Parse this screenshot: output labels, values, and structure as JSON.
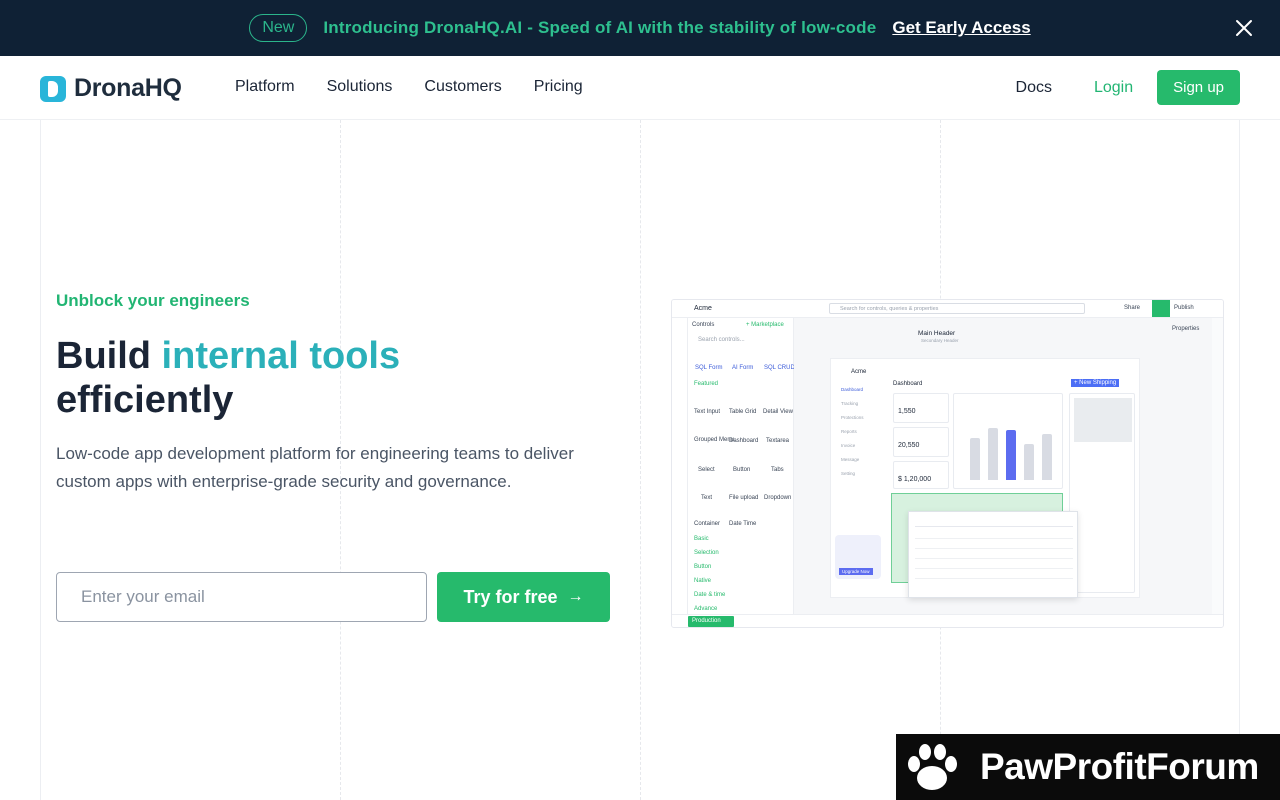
{
  "announcement": {
    "badge": "New",
    "message": "Introducing DronaHQ.AI - Speed of AI with the stability of low-code",
    "cta": "Get Early Access"
  },
  "brand": {
    "name": "DronaHQ"
  },
  "nav": {
    "links": [
      "Platform",
      "Solutions",
      "Customers",
      "Pricing"
    ],
    "docs": "Docs",
    "login": "Login",
    "signup": "Sign up"
  },
  "hero": {
    "eyebrow": "Unblock your engineers",
    "headline_start": "Build ",
    "headline_highlight": "internal tools",
    "headline_end": "efficiently",
    "subcopy": "Low-code app development platform for engineering teams to deliver custom apps with enterprise-grade security and governance.",
    "email_placeholder": "Enter your email",
    "cta": "Try for free"
  },
  "mock": {
    "app_name": "Acme",
    "search_placeholder": "Search for controls, queries & properties",
    "share": "Share",
    "publish": "Publish",
    "properties": "Properties",
    "controls_title": "Controls",
    "marketplace": "+ Marketplace",
    "controls_search": "Search controls...",
    "top_controls": [
      "SQL Form",
      "AI Form",
      "SQL CRUD"
    ],
    "featured_label": "Featured",
    "featured": [
      "Text Input",
      "Table Grid",
      "Detail View",
      "Grouped Menu",
      "Dashboard",
      "Textarea",
      "Select",
      "Button",
      "Tabs",
      "Text",
      "File upload",
      "Dropdown",
      "Container",
      "Date Time"
    ],
    "categories": [
      "Basic",
      "Selection",
      "Button",
      "Native",
      "Date & time",
      "Advance"
    ],
    "main_header": "Main Header",
    "main_sub": "Secondary Header",
    "dashboard_title": "Dashboard",
    "new_shipping": "+ New Shipping",
    "sidebar_items": [
      "Dashboard",
      "Tracking",
      "Protections",
      "Reports",
      "Invoice",
      "Message",
      "Setting"
    ],
    "kpis": [
      "1,550",
      "20,550",
      "$ 1,20,000"
    ],
    "upgrade": "Upgrade Now",
    "environment": "Production"
  },
  "watermark": {
    "text": "PawProfitForum"
  },
  "colors": {
    "green": "#26ba6c",
    "navy": "#0f2135",
    "teal": "#2bb0b9"
  }
}
